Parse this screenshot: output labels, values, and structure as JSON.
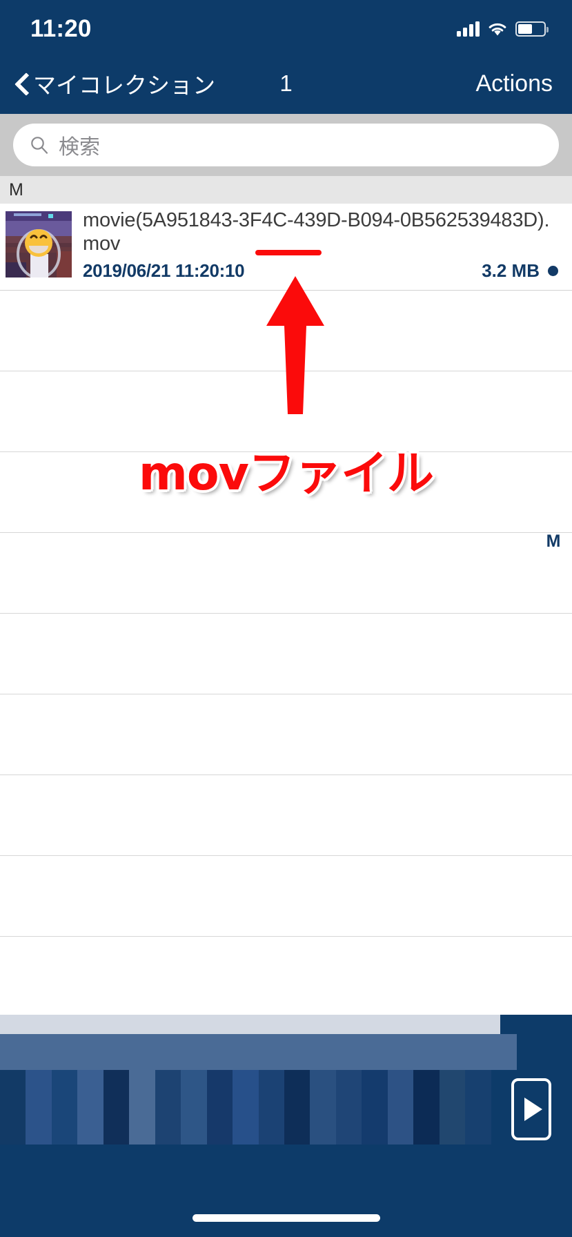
{
  "status_bar": {
    "time": "11:20",
    "signal_icon": "cellular-signal-icon",
    "wifi_icon": "wifi-icon",
    "battery_icon": "battery-icon",
    "battery_level_pct": 55
  },
  "nav_bar": {
    "back_icon": "chevron-left-icon",
    "back_label": "マイコレクション",
    "title": "1",
    "action_label": "Actions",
    "background_color": "#0d3b69"
  },
  "search": {
    "icon": "search-icon",
    "placeholder": "検索",
    "value": ""
  },
  "section": {
    "index_letter": "M"
  },
  "file_row": {
    "thumbnail_name": "video-thumbnail",
    "name": "movie(5A951843-3F4C-439D-B094-0B562539483D).mov",
    "date": "2019/06/21 11:20:10",
    "size": "3.2 MB",
    "status_dot_color": "#123a66"
  },
  "index_strip": {
    "letter": "M"
  },
  "annotation": {
    "text": "movファイル",
    "color": "#fb0b0b",
    "underline_name": "red-underline-mark",
    "arrow_name": "red-arrow-annotation"
  },
  "bottom_player": {
    "play_icon": "play-button-icon",
    "home_indicator": "home-indicator"
  },
  "empty_rows": [
    1,
    2,
    3,
    4,
    5,
    6,
    7,
    8,
    9
  ]
}
